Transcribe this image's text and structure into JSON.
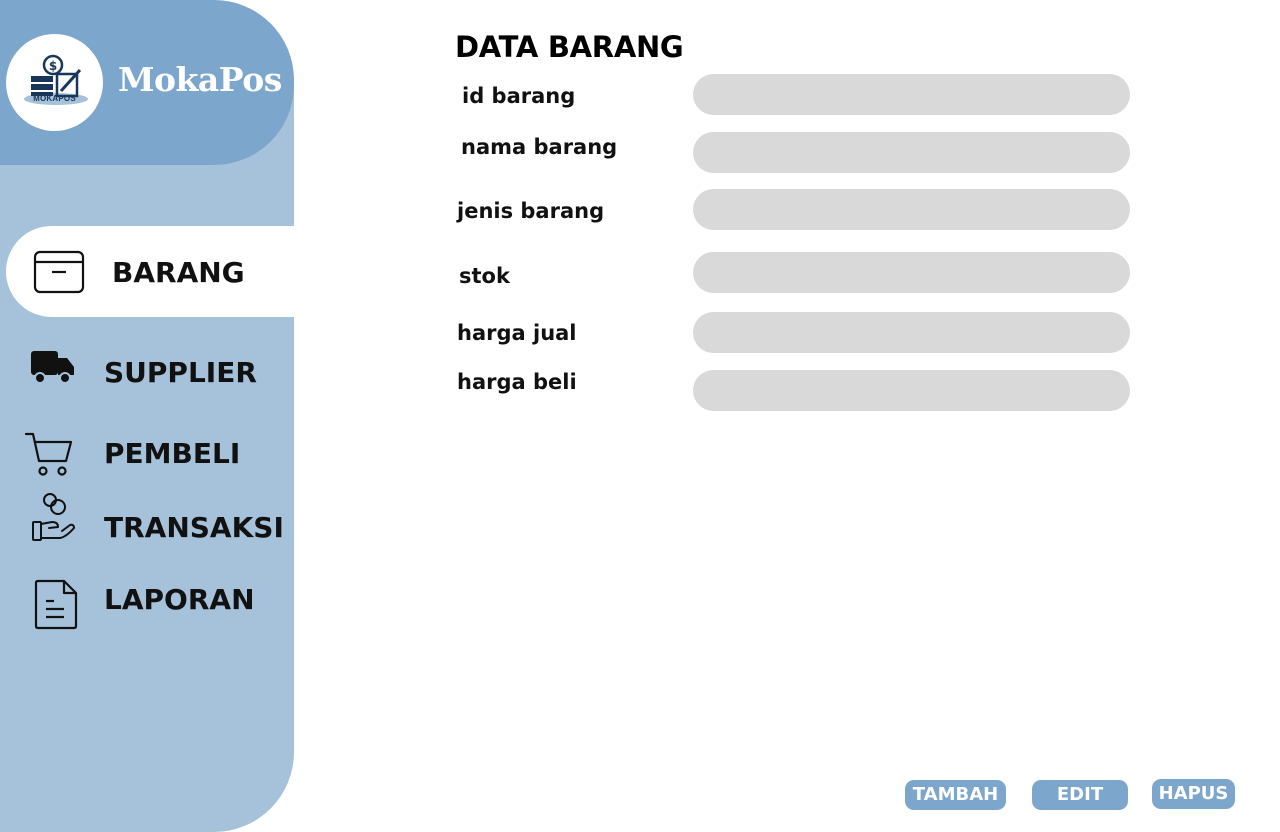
{
  "brand": {
    "name": "MokaPos",
    "logo_text": "MOKAPOS",
    "accent_color": "#7ca6cb",
    "sidebar_color": "#a6c2da"
  },
  "sidebar": {
    "items": [
      {
        "label": "BARANG",
        "icon": "box-icon",
        "active": true
      },
      {
        "label": "SUPPLIER",
        "icon": "truck-icon",
        "active": false
      },
      {
        "label": "PEMBELI",
        "icon": "cart-icon",
        "active": false
      },
      {
        "label": "TRANSAKSI",
        "icon": "hand-coins-icon",
        "active": false
      },
      {
        "label": "LAPORAN",
        "icon": "document-icon",
        "active": false
      }
    ]
  },
  "main": {
    "title": "DATA BARANG",
    "fields": [
      {
        "label": "id barang",
        "value": ""
      },
      {
        "label": "nama barang",
        "value": ""
      },
      {
        "label": "jenis barang",
        "value": ""
      },
      {
        "label": "stok",
        "value": ""
      },
      {
        "label": "harga jual",
        "value": ""
      },
      {
        "label": "harga beli",
        "value": ""
      }
    ],
    "input_color": "#d9d9d9"
  },
  "actions": {
    "add_label": "TAMBAH",
    "edit_label": "EDIT",
    "delete_label": "HAPUS"
  }
}
